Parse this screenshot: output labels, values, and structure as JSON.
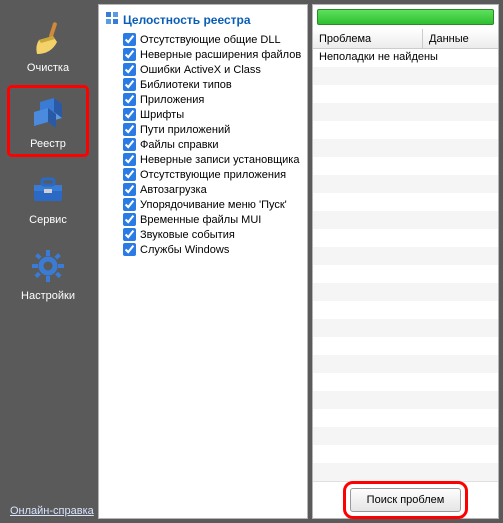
{
  "sidebar": {
    "items": [
      {
        "label": "Очистка",
        "icon": "broom-icon"
      },
      {
        "label": "Реестр",
        "icon": "registry-cube-icon",
        "selected": true
      },
      {
        "label": "Сервис",
        "icon": "toolbox-icon"
      },
      {
        "label": "Настройки",
        "icon": "gear-icon"
      }
    ]
  },
  "help_link": "Онлайн-справка",
  "check_panel": {
    "title": "Целостность реестра",
    "items": [
      {
        "label": "Отсутствующие общие DLL",
        "checked": true
      },
      {
        "label": "Неверные расширения файлов",
        "checked": true
      },
      {
        "label": "Ошибки ActiveX и Class",
        "checked": true
      },
      {
        "label": "Библиотеки типов",
        "checked": true
      },
      {
        "label": "Приложения",
        "checked": true
      },
      {
        "label": "Шрифты",
        "checked": true
      },
      {
        "label": "Пути приложений",
        "checked": true
      },
      {
        "label": "Файлы справки",
        "checked": true
      },
      {
        "label": "Неверные записи установщика",
        "checked": true
      },
      {
        "label": "Отсутствующие приложения",
        "checked": true
      },
      {
        "label": "Автозагрузка",
        "checked": true
      },
      {
        "label": "Упорядочивание меню 'Пуск'",
        "checked": true
      },
      {
        "label": "Временные файлы MUI",
        "checked": true
      },
      {
        "label": "Звуковые события",
        "checked": true
      },
      {
        "label": "Службы Windows",
        "checked": true
      }
    ]
  },
  "results": {
    "columns": [
      "Проблема",
      "Данные"
    ],
    "rows": [
      {
        "problem": "Неполадки не найдены",
        "data": ""
      }
    ]
  },
  "actions": {
    "search_label": "Поиск проблем"
  }
}
